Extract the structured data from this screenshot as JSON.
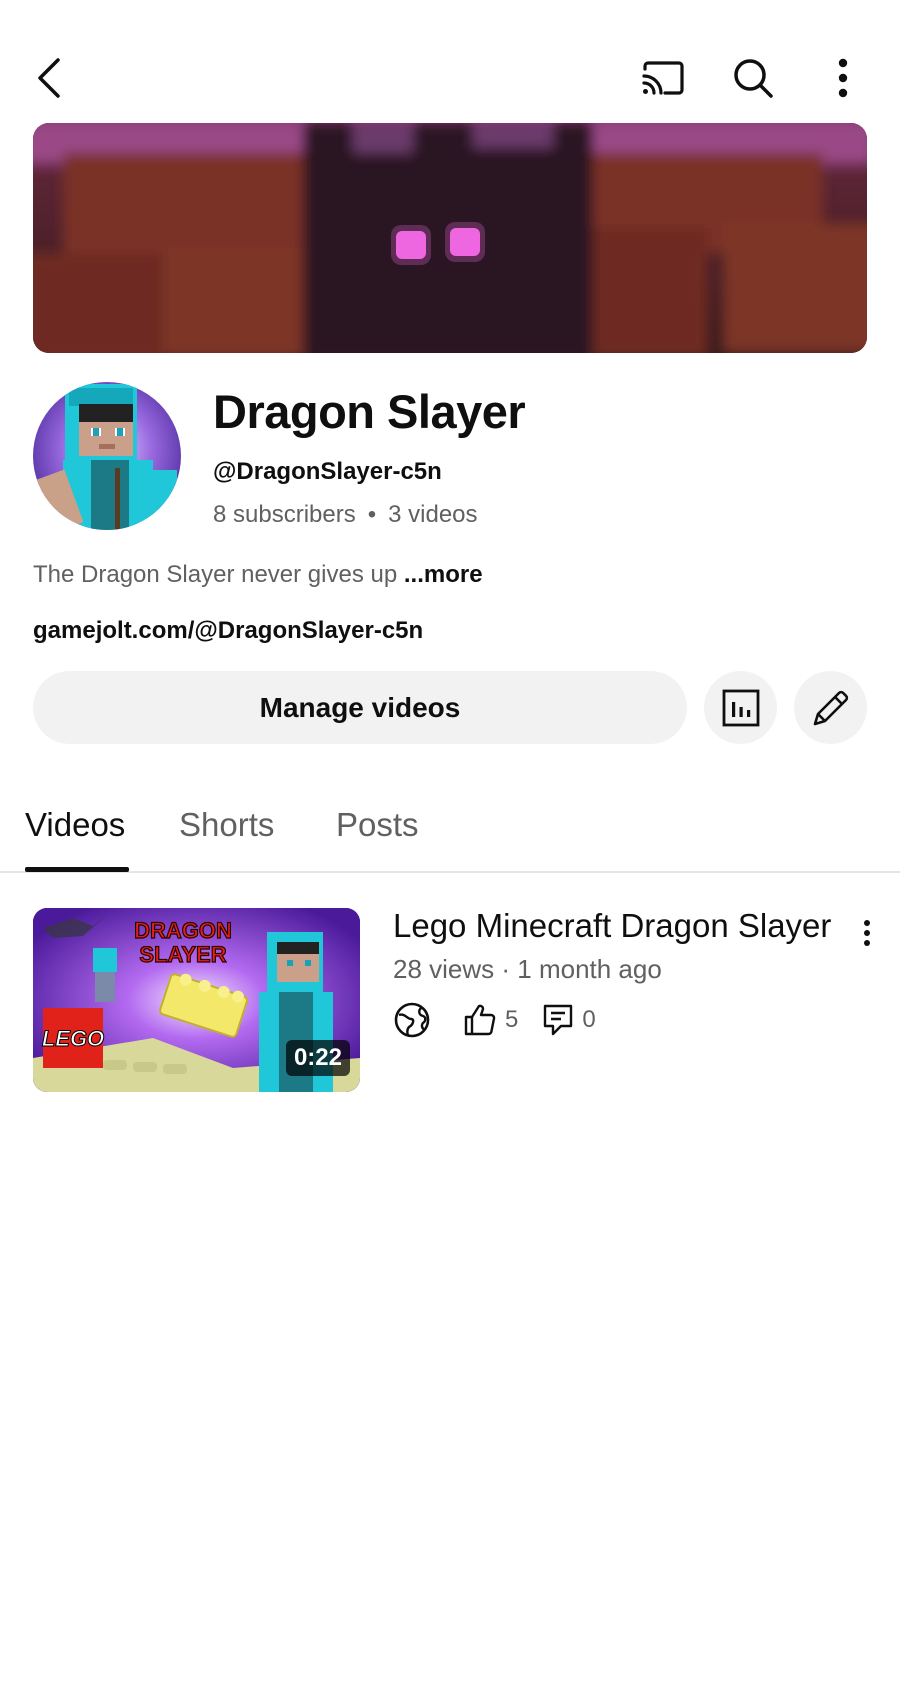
{
  "topbar": {
    "back_icon": "back-arrow-icon",
    "cast_icon": "cast-icon",
    "search_icon": "search-icon",
    "more_icon": "more-vertical-icon"
  },
  "channel": {
    "name": "Dragon Slayer",
    "handle": "@DragonSlayer-c5n",
    "subscribers": "8 subscribers",
    "separator": "•",
    "videos_count": "3 videos",
    "description": "The Dragon Slayer never gives up",
    "description_more": "...more",
    "link": "gamejolt.com/@DragonSlayer-c5n"
  },
  "actions": {
    "manage_label": "Manage videos",
    "analytics_icon": "analytics-icon",
    "edit_icon": "pencil-icon"
  },
  "tabs": [
    {
      "label": "Videos",
      "active": true
    },
    {
      "label": "Shorts",
      "active": false
    },
    {
      "label": "Posts",
      "active": false
    }
  ],
  "videos": [
    {
      "title": "Lego Minecraft Dragon Slayer",
      "meta": "28 views · 1 month ago",
      "duration": "0:22",
      "likes": "5",
      "comments": "0",
      "thumb_text_1": "DRAGON",
      "thumb_text_2": "SLAYER",
      "thumb_logo": "LEGO"
    }
  ],
  "colors": {
    "primary_text": "#0f0f0f",
    "secondary_text": "#606060",
    "button_bg": "#f2f2f2"
  }
}
